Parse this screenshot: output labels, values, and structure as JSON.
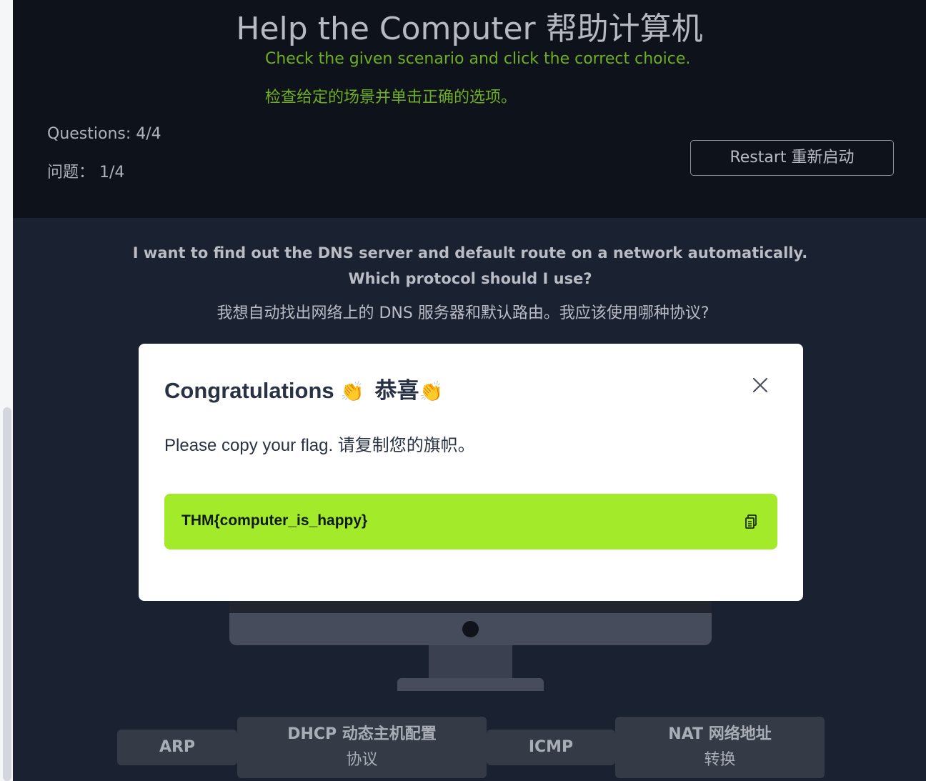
{
  "header": {
    "title": "Help the Computer  帮助计算机",
    "subtitle_en": "Check the given scenario and click the correct choice.",
    "subtitle_zh": "检查给定的场景并单击正确的选项。",
    "questions_en": "Questions: 4/4",
    "questions_zh": "问题：  1/4",
    "restart_label": "Restart  重新启动"
  },
  "question": {
    "text_en": "I want to find out the DNS server and default route on a network automatically. Which protocol should I use?",
    "text_zh": "我想自动找出网络上的 DNS 服务器和默认路由。我应该使用哪种协议?"
  },
  "answers": [
    {
      "label": "ARP",
      "label_zh": ""
    },
    {
      "label": "DHCP  动态主机配置",
      "label_zh": "协议"
    },
    {
      "label": "ICMP",
      "label_zh": ""
    },
    {
      "label": "NAT  网络地址",
      "label_zh": "转换"
    }
  ],
  "modal": {
    "title_en": "Congratulations",
    "title_zh": "恭喜",
    "clap": "👏",
    "message": "Please copy your flag.  请复制您的旗帜。",
    "flag": "THM{computer_is_happy}",
    "icons": {
      "close": "close-icon",
      "copy": "copy-icon"
    }
  },
  "colors": {
    "accent_green": "#6fae23",
    "flag_bg": "#a3ea2a",
    "header_bg": "#0e121b",
    "page_bg": "#1a2130"
  }
}
